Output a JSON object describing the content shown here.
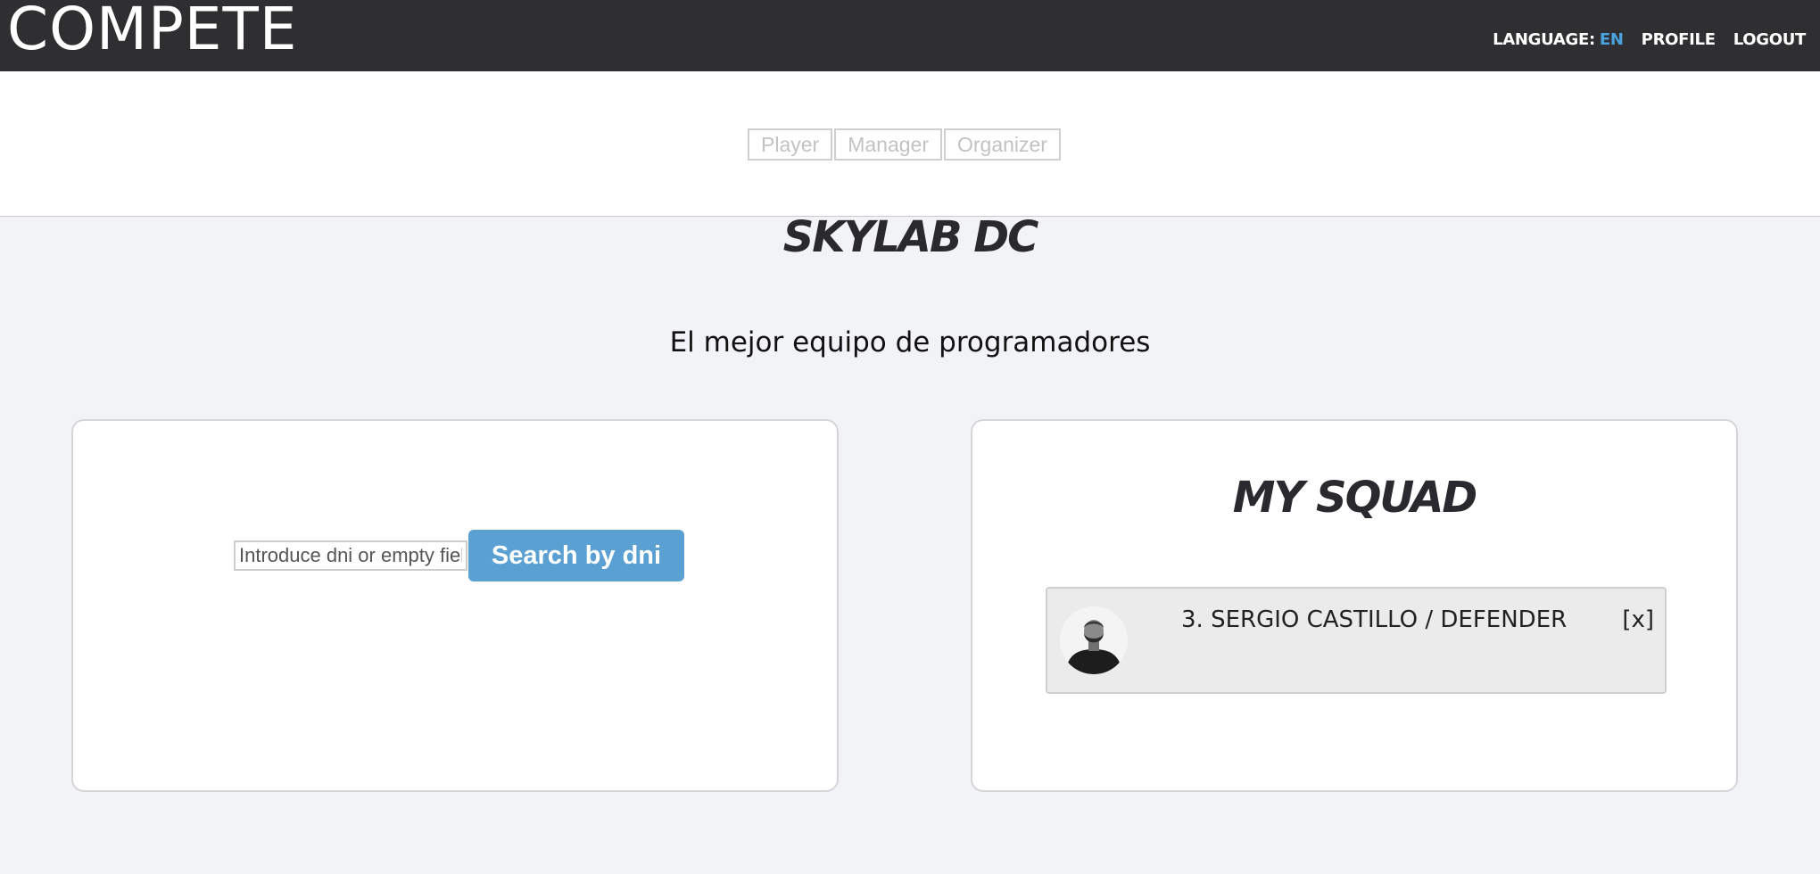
{
  "header": {
    "brand": "COMPETE",
    "language_label": "LANGUAGE:",
    "language_code": "EN",
    "profile_label": "PROFILE",
    "logout_label": "LOGOUT"
  },
  "roles": [
    "Player",
    "Manager",
    "Organizer"
  ],
  "team": {
    "name": "SKYLAB DC",
    "description": "El mejor equipo de programadores"
  },
  "search": {
    "placeholder": "Introduce dni or empty field",
    "button_label": "Search by dni"
  },
  "squad": {
    "title": "MY SQUAD",
    "players": [
      {
        "label": "3. SERGIO CASTILLO / DEFENDER",
        "remove_label": "[x]",
        "avatar_icon": "player-avatar-icon"
      }
    ]
  },
  "colors": {
    "header_bg": "#2f2f31",
    "accent": "#4aa3df",
    "button_bg": "#5aa0d2",
    "page_bg": "#f2f3f6"
  }
}
